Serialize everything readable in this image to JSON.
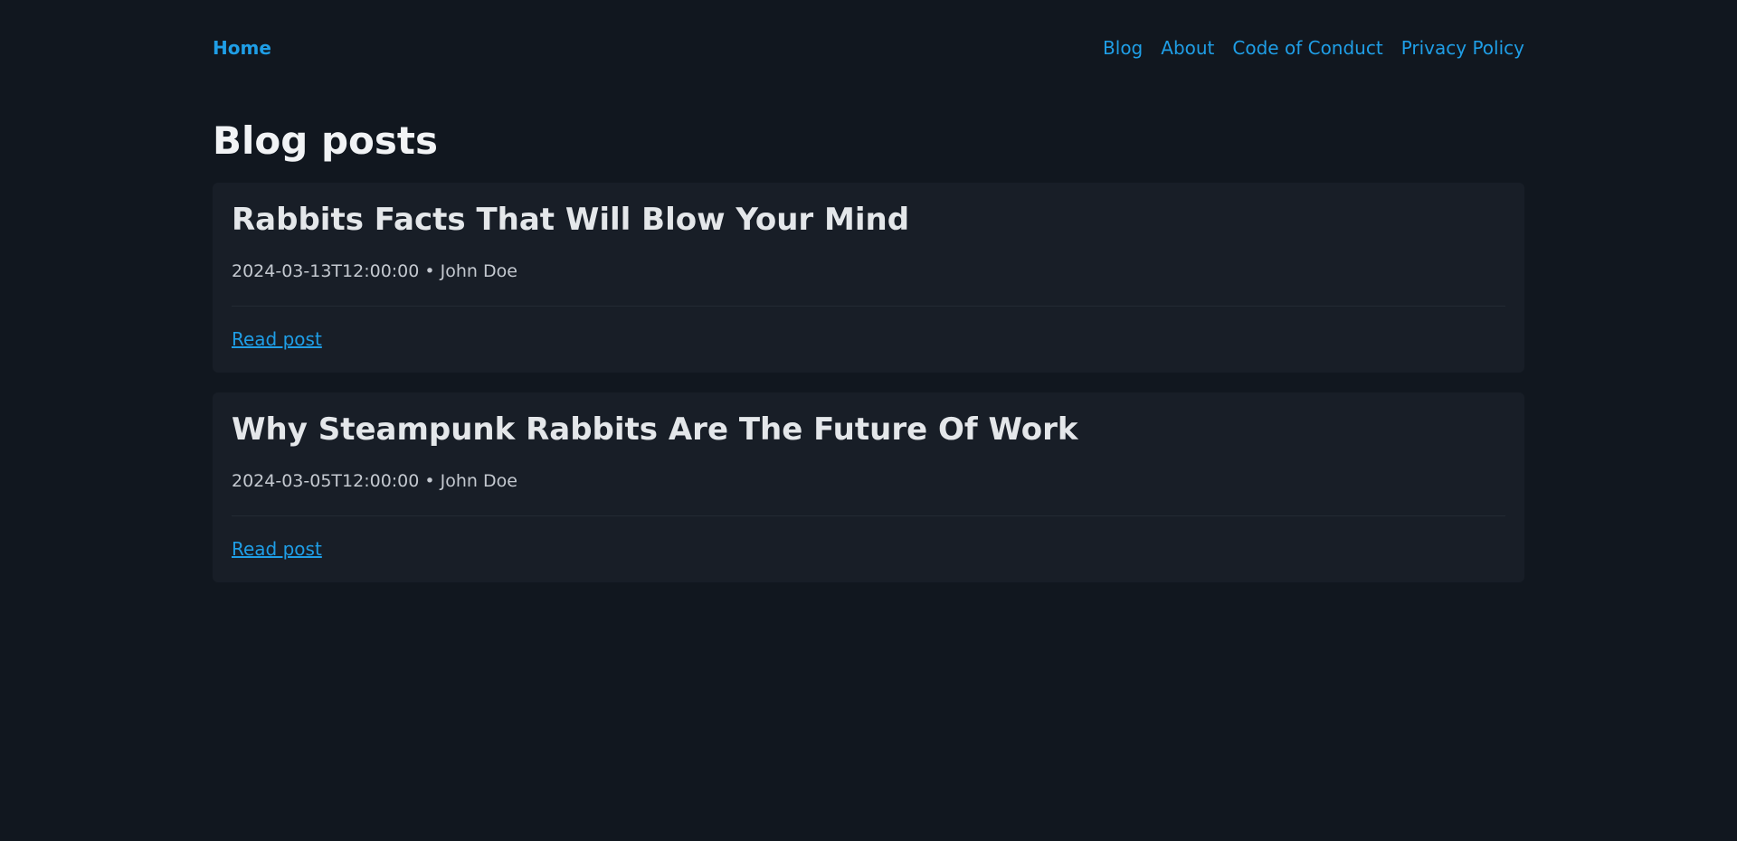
{
  "nav": {
    "home": "Home",
    "links": [
      {
        "label": "Blog"
      },
      {
        "label": "About"
      },
      {
        "label": "Code of Conduct"
      },
      {
        "label": "Privacy Policy"
      }
    ]
  },
  "page": {
    "title": "Blog posts"
  },
  "posts": [
    {
      "title": "Rabbits Facts That Will Blow Your Mind",
      "meta": "2024-03-13T12:00:00 • John Doe",
      "link": "Read post"
    },
    {
      "title": "Why Steampunk Rabbits Are The Future Of Work",
      "meta": "2024-03-05T12:00:00 • John Doe",
      "link": "Read post"
    }
  ],
  "colors": {
    "background": "#11171f",
    "card": "#181e27",
    "accent": "#1f9ee6",
    "heading": "#e4e7ea",
    "meta": "#c4c9d0"
  }
}
